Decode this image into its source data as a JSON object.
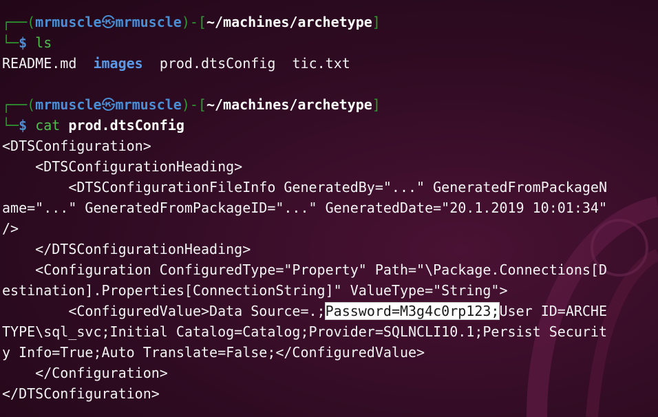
{
  "prompt1": {
    "user": "mrmuscle",
    "host": "mrmuscle",
    "path": "~/machines/archetype",
    "command": "ls",
    "args": ""
  },
  "ls_output": {
    "files": [
      "README.md",
      "images",
      "prod.dtsConfig",
      "tic.txt"
    ]
  },
  "prompt2": {
    "user": "mrmuscle",
    "host": "mrmuscle",
    "path": "~/machines/archetype",
    "command": "cat",
    "args": "prod.dtsConfig"
  },
  "file_output": {
    "l1": "<DTSConfiguration>",
    "l2": "    <DTSConfigurationHeading>",
    "l3": "        <DTSConfigurationFileInfo GeneratedBy=\"...\" GeneratedFromPackageN",
    "l4": "ame=\"...\" GeneratedFromPackageID=\"...\" GeneratedDate=\"20.1.2019 10:01:34\"",
    "l5": "/>",
    "l6": "    </DTSConfigurationHeading>",
    "l7": "    <Configuration ConfiguredType=\"Property\" Path=\"\\Package.Connections[D",
    "l8": "estination].Properties[ConnectionString]\" ValueType=\"String\">",
    "l9_before": "        <ConfiguredValue>Data Source=.;",
    "l9_highlight": "Password=M3g4c0rp123;",
    "l9_after": "User ID=ARCHE",
    "l10": "TYPE\\sql_svc;Initial Catalog=Catalog;Provider=SQLNCLI10.1;Persist Securit",
    "l11": "y Info=True;Auto Translate=False;</ConfiguredValue>",
    "l12": "    </Configuration>",
    "l13": "</DTSConfiguration>"
  },
  "colors": {
    "background": "#2f0b22",
    "prompt_frame": "#2d9a32",
    "user_host": "#4a8fd6",
    "command": "#4fbf4f",
    "directory": "#5a9ae8",
    "highlight_bg": "#ffffff"
  },
  "icons": {
    "user_host_separator": "skull-icon"
  }
}
